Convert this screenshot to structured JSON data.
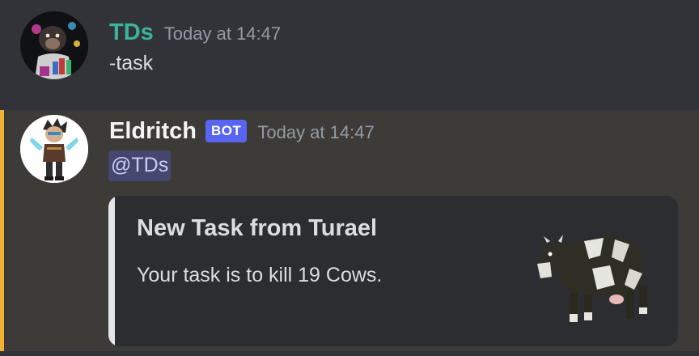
{
  "messages": [
    {
      "username": "TDs",
      "timestamp": "Today at 14:47",
      "content": "-task",
      "avatar_icon": "monkey-avatar",
      "username_color": "#3cb39b"
    },
    {
      "username": "Eldritch",
      "bot_tag": "BOT",
      "timestamp": "Today at 14:47",
      "mention": "@TDs",
      "avatar_icon": "warrior-avatar",
      "highlight_color": "#f0b232",
      "embed": {
        "title": "New Task from Turael",
        "description": "Your task is to kill 19 Cows.",
        "thumbnail_icon": "cow-image",
        "accent_color": "#e3e5e8"
      }
    }
  ]
}
